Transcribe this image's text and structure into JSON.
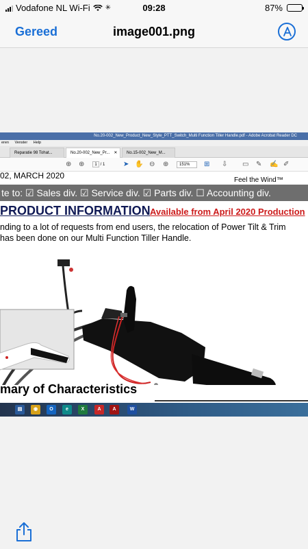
{
  "status_bar": {
    "carrier": "Vodafone NL Wi-Fi",
    "time": "09:28",
    "battery": "87%",
    "battery_level": 0.87
  },
  "nav": {
    "done_label": "Gereed",
    "title": "image001.png",
    "markup_icon": "markup-pen-icon"
  },
  "acrobat": {
    "window_title": "No.20-002_New_Product_New_Style_PTT_Switch_Multi Function Tiller Handle.pdf - Adobe Acrobat Reader DC",
    "menu": [
      "eren",
      "Venster",
      "Help"
    ],
    "tabs": [
      {
        "label": "Reparatie 98 Tohat...",
        "active": false
      },
      {
        "label": "No.20-002_New_Pr...",
        "active": true
      },
      {
        "label": "No.15-002_New_M...",
        "active": false
      }
    ],
    "page_current": "1",
    "page_total": "/ 1",
    "zoom": "151%"
  },
  "document": {
    "date": "02, MARCH 2020",
    "tagline": "Feel the Wind™",
    "route": "te to: ☑ Sales div.  ☑ Service div.  ☑ Parts div. ☐ Accounting div.",
    "heading": "PRODUCT INFORMATION",
    "available": "Available from April 2020 Production",
    "body_line1": "nding to a lot of requests from end users, the relocation of Power Tilt & Trim",
    "body_line2": " has been done on our Multi Function Tiller Handle.",
    "summary": "mary of Characteristics"
  },
  "taskbar": {
    "apps": [
      {
        "name": "file-explorer-icon",
        "glyph": "▤",
        "color": "#2a5a9a"
      },
      {
        "name": "chrome-icon",
        "glyph": "◉",
        "color": "#d6a11a"
      },
      {
        "name": "outlook-icon",
        "glyph": "O",
        "color": "#1565c0"
      },
      {
        "name": "edge-icon",
        "glyph": "e",
        "color": "#0f8a8a"
      },
      {
        "name": "excel-icon",
        "glyph": "X",
        "color": "#1f7a3e"
      },
      {
        "name": "acrobat-icon",
        "glyph": "A",
        "color": "#c62828"
      },
      {
        "name": "acrobat-active-icon",
        "glyph": "A",
        "color": "#a01515"
      },
      {
        "name": "word-icon",
        "glyph": "W",
        "color": "#1e4fa0"
      }
    ]
  }
}
